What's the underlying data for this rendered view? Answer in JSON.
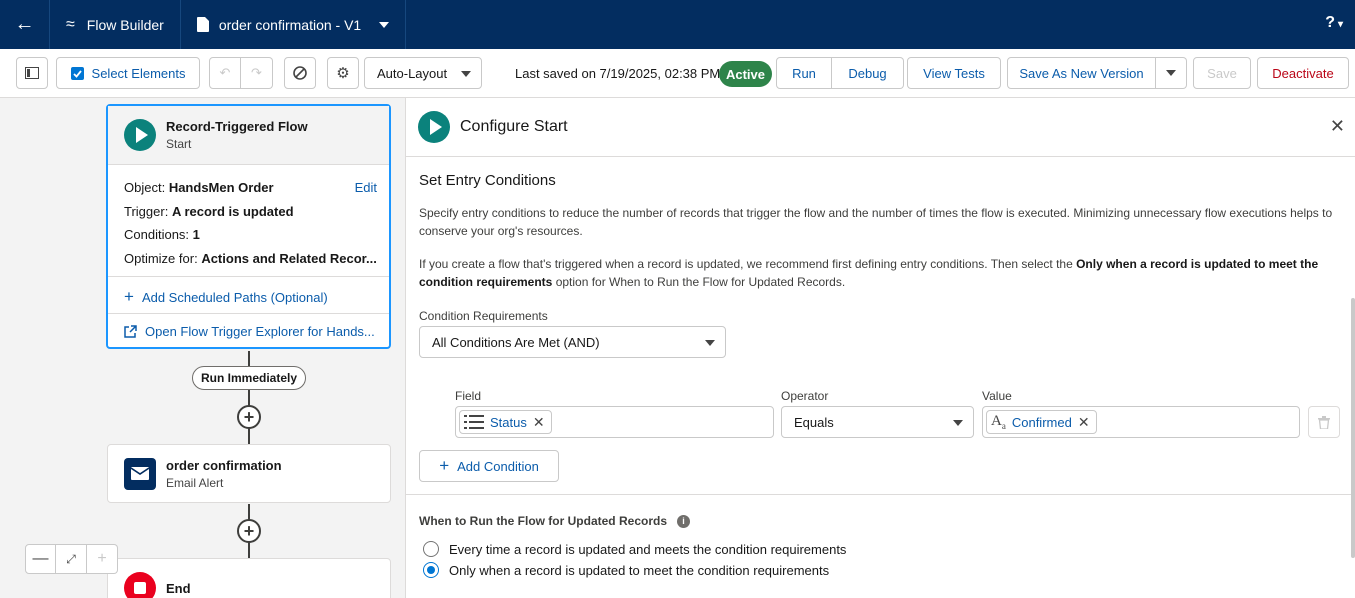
{
  "header": {
    "app_name": "Flow Builder",
    "file_name": "order confirmation - V1",
    "help_label": "?"
  },
  "toolbar": {
    "select_elements": "Select Elements",
    "layout_value": "Auto-Layout",
    "last_saved": "Last saved on 7/19/2025, 02:38 PM",
    "status_badge": "Active",
    "run": "Run",
    "debug": "Debug",
    "view_tests": "View Tests",
    "save_as_new_version": "Save As New Version",
    "save": "Save",
    "deactivate": "Deactivate"
  },
  "canvas": {
    "start": {
      "title": "Record-Triggered Flow",
      "subtitle": "Start",
      "object_label": "Object:",
      "object_value": "HandsMen Order",
      "edit": "Edit",
      "trigger_label": "Trigger:",
      "trigger_value": "A record is updated",
      "conditions_label": "Conditions:",
      "conditions_value": "1",
      "optimize_label": "Optimize for:",
      "optimize_value": "Actions and Related Recor...",
      "add_scheduled": "Add Scheduled Paths (Optional)",
      "open_explorer": "Open Flow Trigger Explorer for Hands..."
    },
    "path_label": "Run Immediately",
    "action": {
      "title": "order confirmation",
      "subtitle": "Email Alert"
    },
    "end": {
      "title": "End"
    }
  },
  "panel": {
    "title": "Configure Start",
    "section_title": "Set Entry Conditions",
    "para1": "Specify entry conditions to reduce the number of records that trigger the flow and the number of times the flow is executed. Minimizing unnecessary flow executions helps to conserve your org's resources.",
    "para2_start": "If you create a flow that's triggered when a record is updated, we recommend first defining entry conditions. Then select the ",
    "para2_bold": "Only when a record is updated to meet the condition requirements",
    "para2_end": " option for When to Run the Flow for Updated Records.",
    "condition_requirements_label": "Condition Requirements",
    "condition_requirements_value": "All Conditions Are Met (AND)",
    "field_label": "Field",
    "field_value": "Status",
    "operator_label": "Operator",
    "operator_value": "Equals",
    "value_label": "Value",
    "value_value": "Confirmed",
    "add_condition": "Add Condition",
    "when_title": "When to Run the Flow for Updated Records",
    "radio_options": [
      "Every time a record is updated and meets the condition requirements",
      "Only when a record is updated to meet the condition requirements"
    ],
    "selected_option_index": 1
  },
  "colors": {
    "header_bg": "#032d60",
    "brand_blue": "#0b5cab",
    "active_green": "#2e844a",
    "start_teal": "#0b827c",
    "end_red": "#ea001e",
    "deactivate_red": "#ba0517"
  }
}
